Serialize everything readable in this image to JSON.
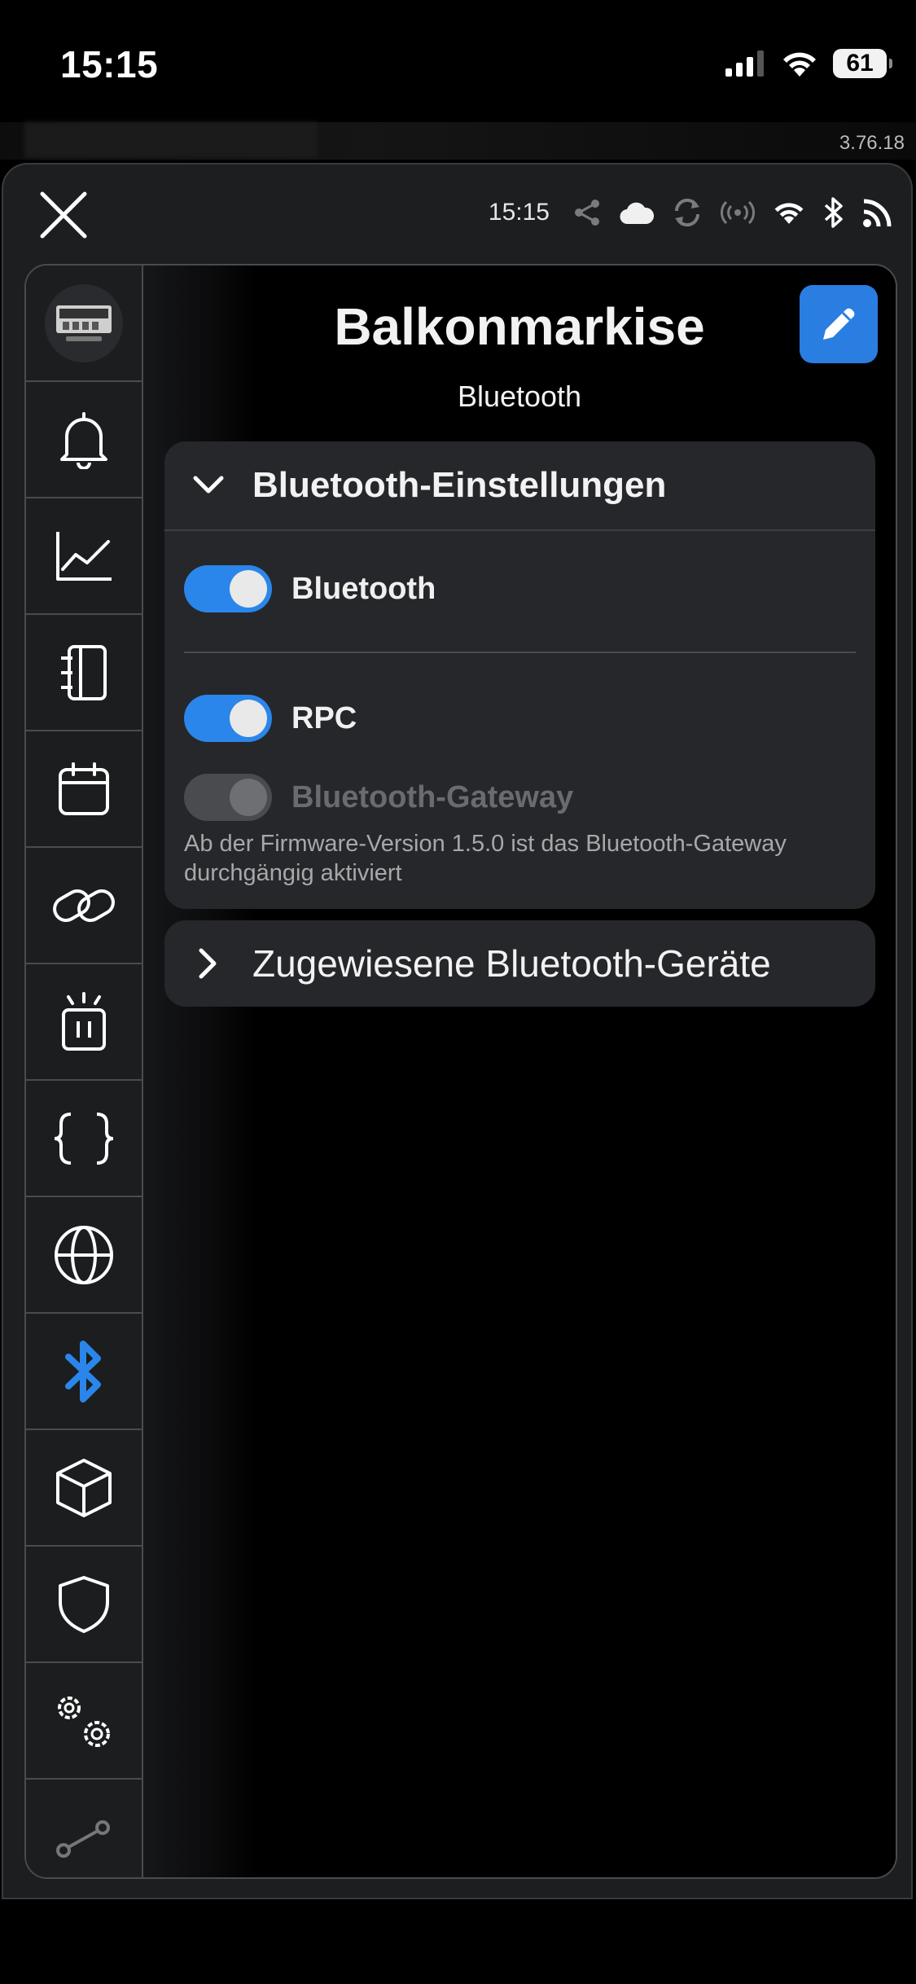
{
  "status_bar": {
    "time": "15:15",
    "battery": "61"
  },
  "app_version": "3.76.18",
  "modal": {
    "top_time": "15:15",
    "top_icons": [
      "share-icon",
      "cloud-icon",
      "sync-icon",
      "broadcast-icon",
      "wifi-icon",
      "bluetooth-icon",
      "rss-icon"
    ]
  },
  "sidebar": {
    "items": [
      {
        "icon": "device-avatar",
        "active": false
      },
      {
        "icon": "bell-icon",
        "active": false
      },
      {
        "icon": "chart-line-icon",
        "active": false
      },
      {
        "icon": "notebook-icon",
        "active": false
      },
      {
        "icon": "calendar-icon",
        "active": false
      },
      {
        "icon": "link-icon",
        "active": false
      },
      {
        "icon": "alarm-icon",
        "active": false
      },
      {
        "icon": "code-braces-icon",
        "active": false
      },
      {
        "icon": "globe-icon",
        "active": false
      },
      {
        "icon": "bluetooth-icon",
        "active": true
      },
      {
        "icon": "cube-icon",
        "active": false
      },
      {
        "icon": "shield-icon",
        "active": false
      },
      {
        "icon": "gears-icon",
        "active": false
      },
      {
        "icon": "graph-icon",
        "active": false
      }
    ],
    "active_color": "#2a86ea"
  },
  "page": {
    "title": "Balkonmarkise",
    "subtitle": "Bluetooth"
  },
  "settings_card": {
    "title": "Bluetooth-Einstellungen",
    "expanded": true,
    "bluetooth": {
      "label": "Bluetooth",
      "on": true
    },
    "rpc": {
      "label": "RPC",
      "on": true
    },
    "gateway": {
      "label": "Bluetooth-Gateway",
      "on": true,
      "disabled": true
    },
    "note": "Ab der Firmware-Version 1.5.0 ist das Bluetooth-Gateway durchgängig aktiviert"
  },
  "devices_card": {
    "title": "Zugewiesene Bluetooth-Geräte",
    "expanded": false
  },
  "colors": {
    "accent": "#2a86ea",
    "edit_button": "#2a7de1",
    "card_bg": "#26272a"
  }
}
